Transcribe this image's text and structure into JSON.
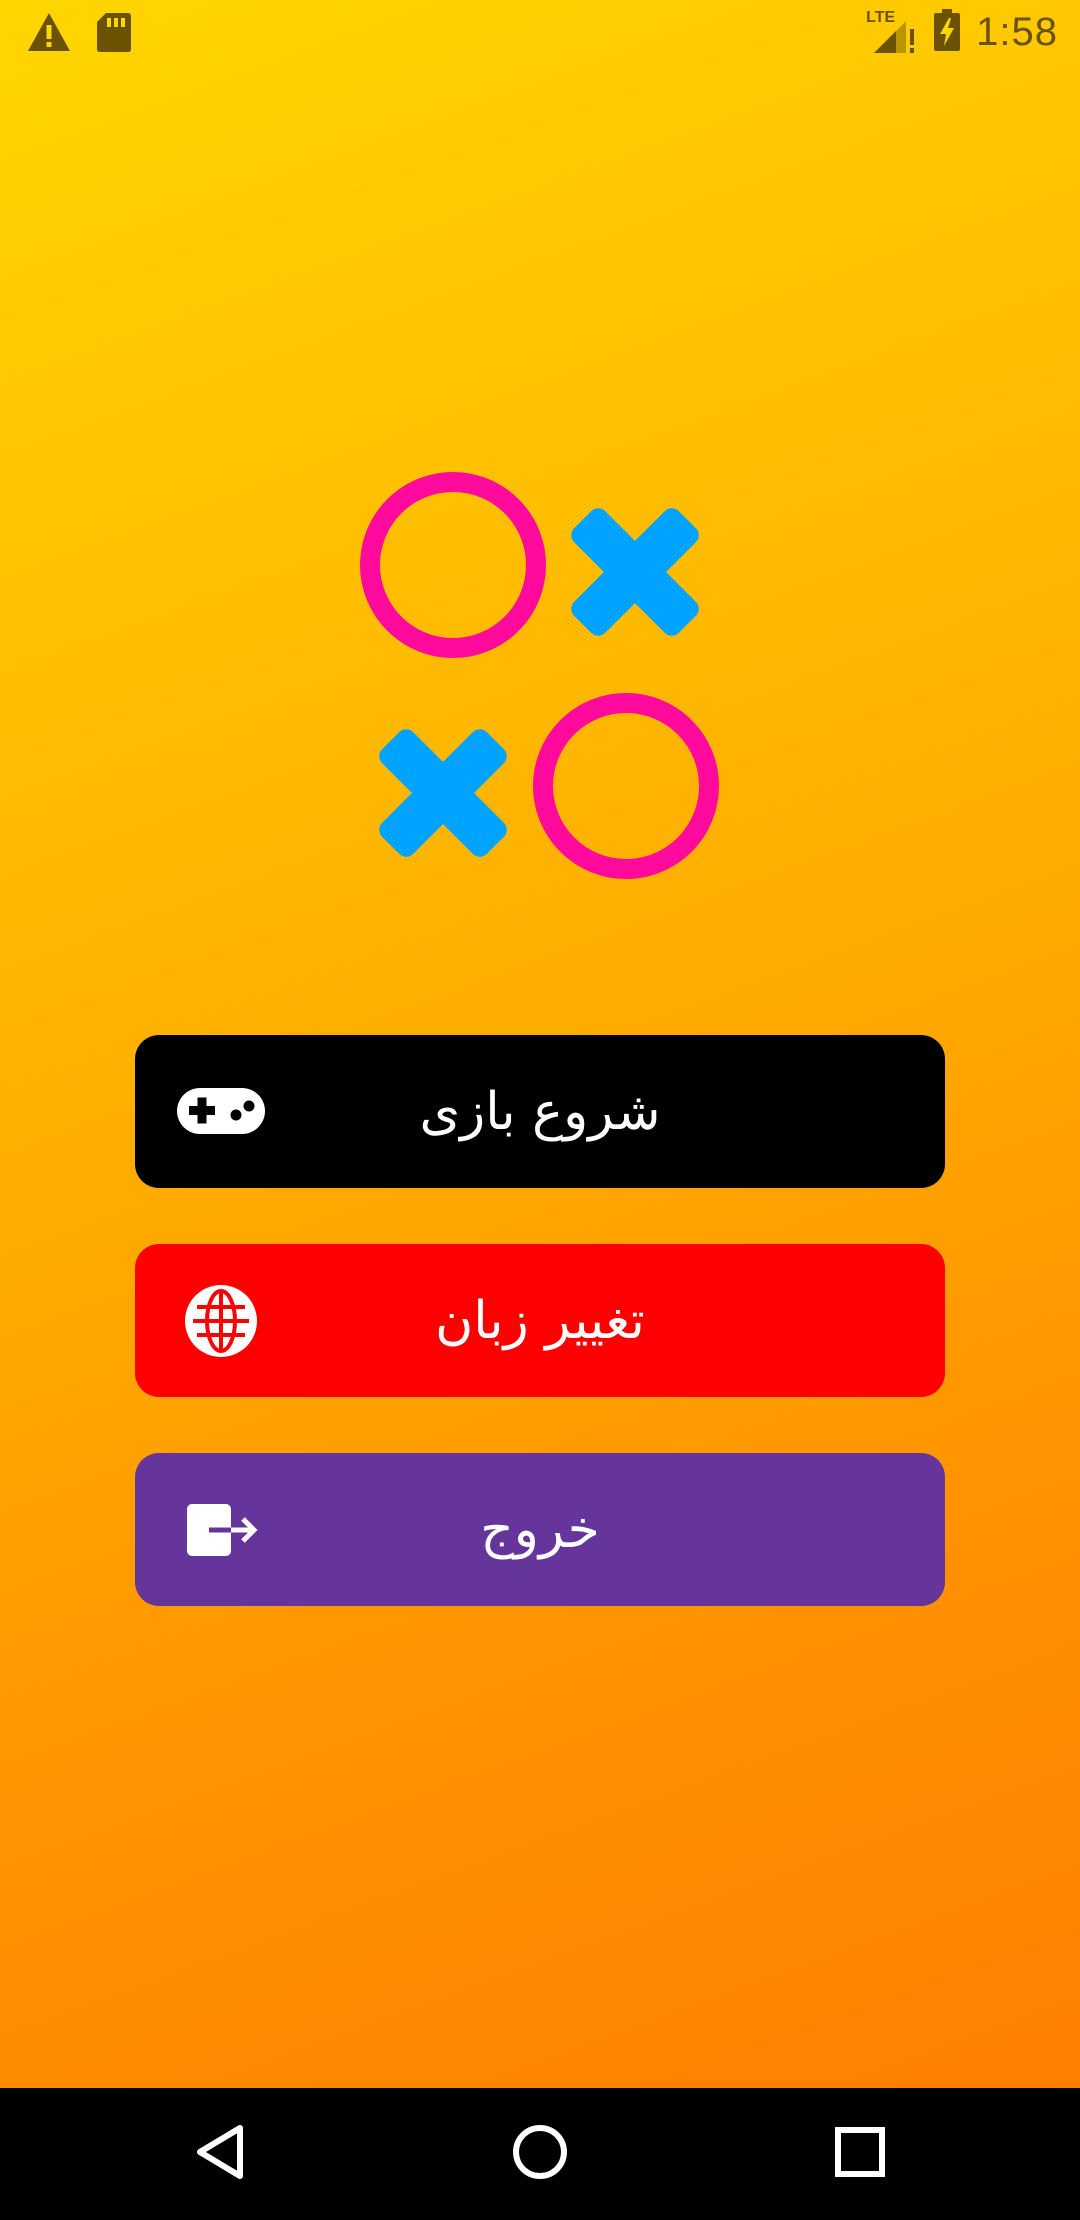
{
  "status_bar": {
    "time": "1:58",
    "network": "LTE",
    "icons": [
      "warning-icon",
      "sd-card-icon",
      "signal-icon",
      "battery-charging-icon"
    ]
  },
  "logo": {
    "cells": [
      "O",
      "X",
      "X",
      "O"
    ],
    "o_color": "#ff0a9c",
    "x_color": "#00a3ff"
  },
  "menu": {
    "buttons": [
      {
        "label": "شروع بازی",
        "icon": "gamepad-icon",
        "color": "#000000"
      },
      {
        "label": "تغییر زبان",
        "icon": "globe-icon",
        "color": "#ff0000"
      },
      {
        "label": "خروج",
        "icon": "exit-icon",
        "color": "#66359c"
      }
    ]
  },
  "nav_bar": {
    "buttons": [
      "back-icon",
      "home-icon",
      "recents-icon"
    ]
  },
  "theme": {
    "background_gradient": [
      "#ffd600",
      "#ff7a00"
    ],
    "status_icon_color": "#6b5200"
  }
}
